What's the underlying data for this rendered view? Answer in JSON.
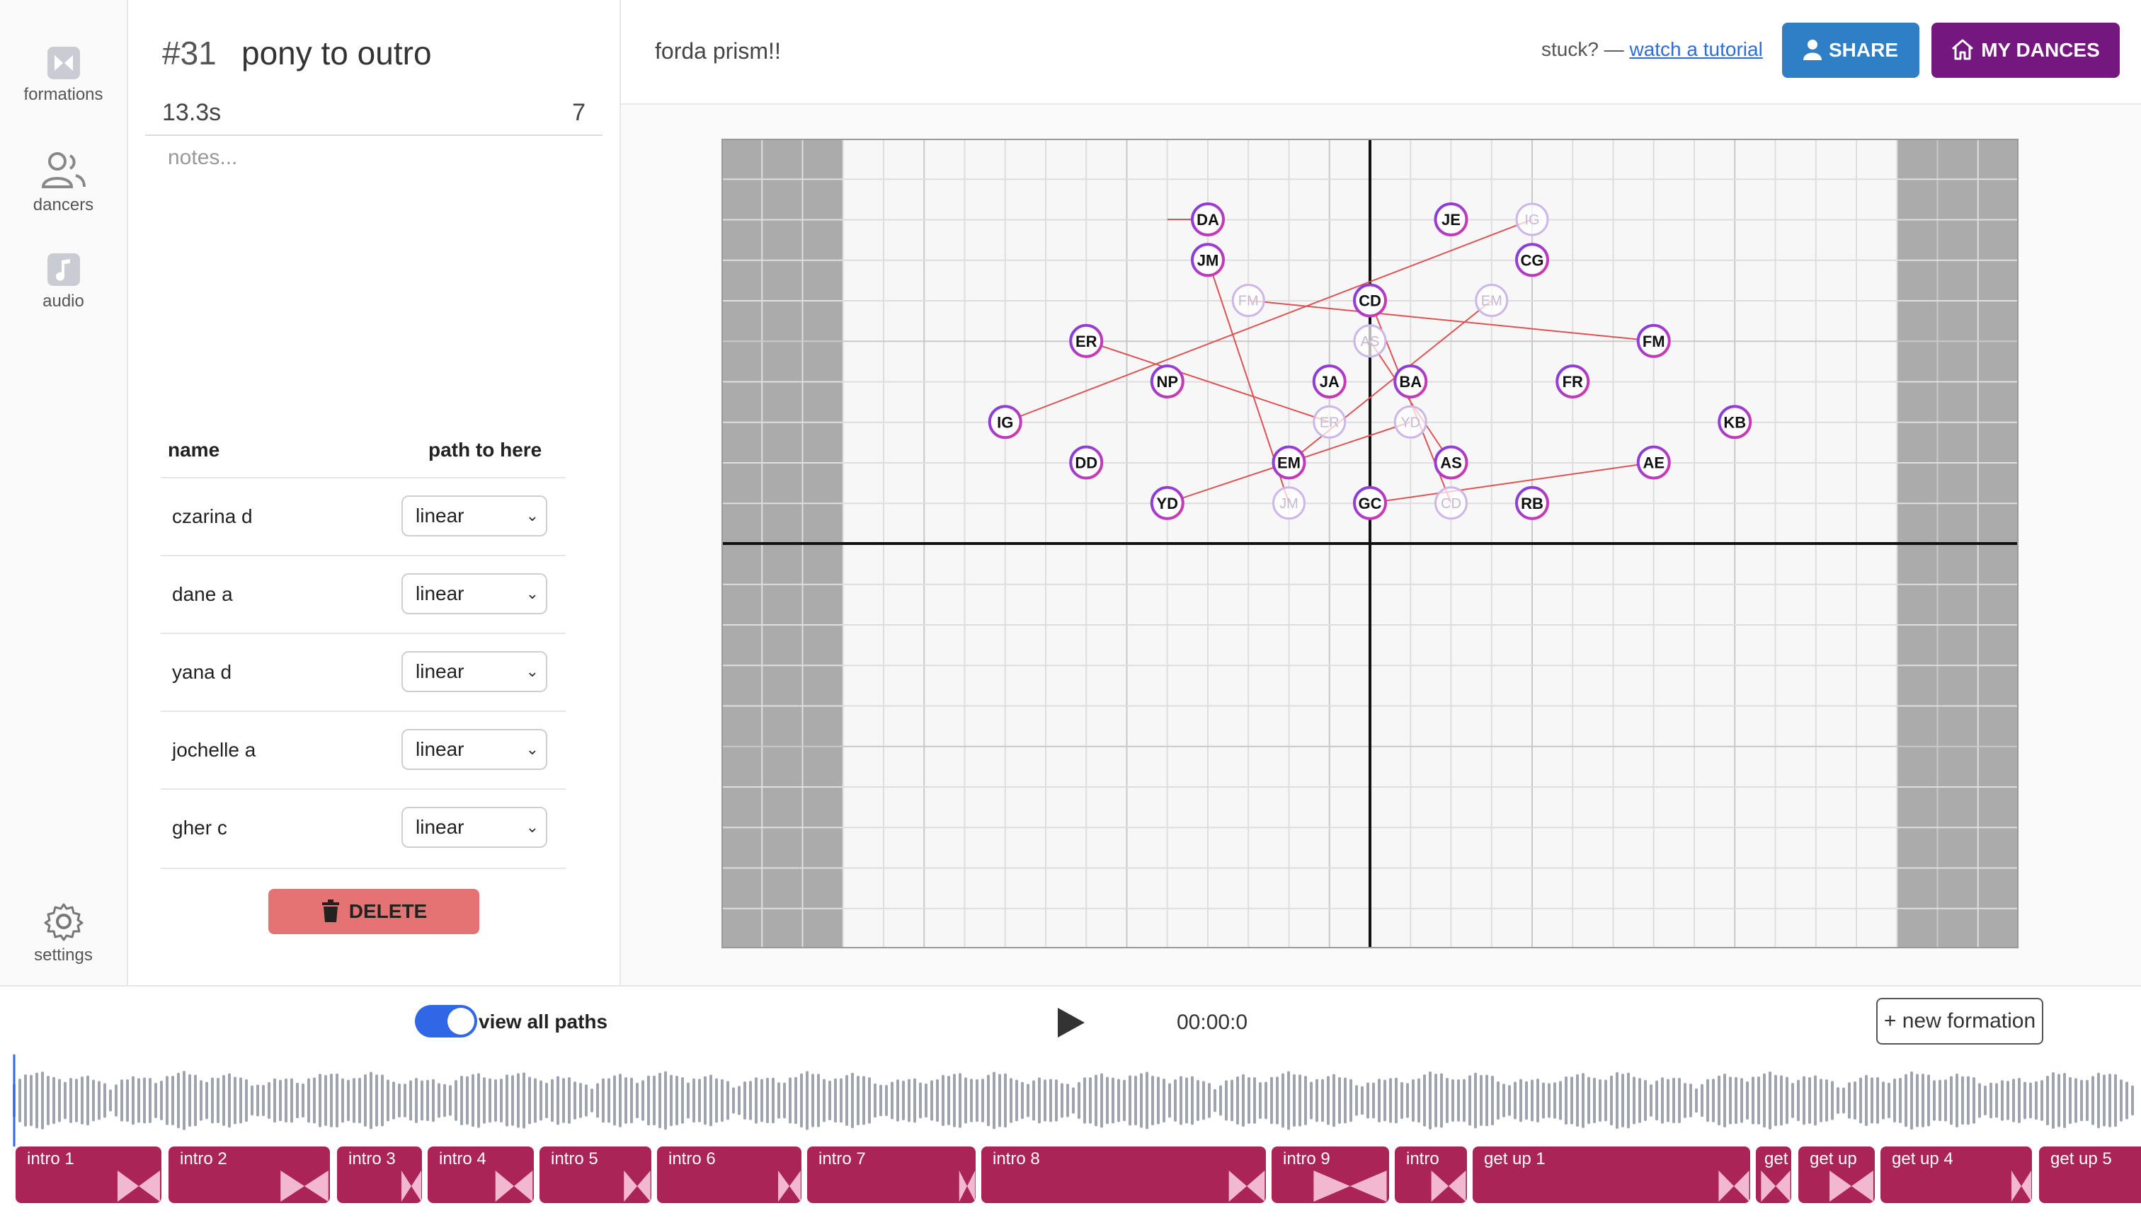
{
  "sidebar": {
    "items": [
      {
        "label": "formations",
        "icon": "bowtie-icon"
      },
      {
        "label": "dancers",
        "icon": "users-icon"
      },
      {
        "label": "audio",
        "icon": "music-note-icon"
      }
    ],
    "settings": {
      "label": "settings",
      "icon": "gear-icon"
    }
  },
  "formation": {
    "number": "#31",
    "name": "pony to outro",
    "duration": "13.3s",
    "count": "7",
    "notes_placeholder": "notes...",
    "table": {
      "col_name": "name",
      "col_path": "path to here",
      "rows": [
        {
          "name": "czarina d",
          "path": "linear"
        },
        {
          "name": "dane a",
          "path": "linear"
        },
        {
          "name": "yana d",
          "path": "linear"
        },
        {
          "name": "jochelle a",
          "path": "linear"
        },
        {
          "name": "gher c",
          "path": "linear"
        }
      ]
    },
    "delete_label": "DELETE"
  },
  "header": {
    "dance_title": "forda prism!!",
    "stuck_text": "stuck? — ",
    "tutorial_link": "watch a tutorial",
    "share_label": "SHARE",
    "my_dances_label": "MY DANCES"
  },
  "stage": {
    "dancers": [
      {
        "id": "DA",
        "x": -4,
        "y": 8
      },
      {
        "id": "JE",
        "x": 2,
        "y": 8
      },
      {
        "id": "JM",
        "x": -4,
        "y": 7
      },
      {
        "id": "CG",
        "x": 4,
        "y": 7
      },
      {
        "id": "CD",
        "x": 0,
        "y": 6
      },
      {
        "id": "ER",
        "x": -7,
        "y": 5
      },
      {
        "id": "FM",
        "x": 7,
        "y": 5
      },
      {
        "id": "NP",
        "x": -5,
        "y": 4
      },
      {
        "id": "JA",
        "x": -1,
        "y": 4
      },
      {
        "id": "BA",
        "x": 1,
        "y": 4
      },
      {
        "id": "FR",
        "x": 5,
        "y": 4
      },
      {
        "id": "IG",
        "x": -9,
        "y": 3
      },
      {
        "id": "KB",
        "x": 9,
        "y": 3
      },
      {
        "id": "DD",
        "x": -7,
        "y": 2
      },
      {
        "id": "EM",
        "x": -2,
        "y": 2
      },
      {
        "id": "AS",
        "x": 2,
        "y": 2
      },
      {
        "id": "AE",
        "x": 7,
        "y": 2
      },
      {
        "id": "YD",
        "x": -5,
        "y": 1
      },
      {
        "id": "GC",
        "x": 0,
        "y": 1
      },
      {
        "id": "RB",
        "x": 4,
        "y": 1
      }
    ],
    "ghosts": [
      {
        "id": "DA",
        "x": -4,
        "y": 8
      },
      {
        "id": "IG",
        "x": 4,
        "y": 8
      },
      {
        "id": "FM",
        "x": -3,
        "y": 6
      },
      {
        "id": "EM",
        "x": 3,
        "y": 6
      },
      {
        "id": "AS",
        "x": 0,
        "y": 5
      },
      {
        "id": "ER",
        "x": -1,
        "y": 3
      },
      {
        "id": "YD",
        "x": 1,
        "y": 3
      },
      {
        "id": "JM",
        "x": -2,
        "y": 1
      },
      {
        "id": "CD",
        "x": 2,
        "y": 1
      }
    ],
    "paths": [
      {
        "from": [
          -5,
          8
        ],
        "to": [
          -4,
          8
        ]
      },
      {
        "from": [
          4,
          8
        ],
        "to": [
          -9,
          3
        ]
      },
      {
        "from": [
          -3,
          6
        ],
        "to": [
          7,
          5
        ]
      },
      {
        "from": [
          3,
          6
        ],
        "to": [
          -2,
          2
        ]
      },
      {
        "from": [
          0,
          5
        ],
        "to": [
          2,
          2
        ]
      },
      {
        "from": [
          -1,
          3
        ],
        "to": [
          -7,
          5
        ]
      },
      {
        "from": [
          1,
          3
        ],
        "to": [
          -5,
          1
        ]
      },
      {
        "from": [
          -2,
          1
        ],
        "to": [
          -4,
          7
        ]
      },
      {
        "from": [
          2,
          1
        ],
        "to": [
          0,
          6
        ]
      },
      {
        "from": [
          0,
          1
        ],
        "to": [
          7,
          2
        ]
      }
    ]
  },
  "controls": {
    "view_all_paths_label": "view all paths",
    "view_all_paths_on": true,
    "timecode": "00:00:0",
    "new_formation_label": "+ new formation"
  },
  "timeline": {
    "formations": [
      {
        "label": "intro 1"
      },
      {
        "label": "intro 2"
      },
      {
        "label": "intro 3"
      },
      {
        "label": "intro 4"
      },
      {
        "label": "intro 5"
      },
      {
        "label": "intro 6"
      },
      {
        "label": "intro 7"
      },
      {
        "label": "intro 8"
      },
      {
        "label": "intro 9"
      },
      {
        "label": "intro"
      },
      {
        "label": "get up 1"
      },
      {
        "label": "get"
      },
      {
        "label": "get up"
      },
      {
        "label": "get up 4"
      },
      {
        "label": "get up 5"
      }
    ]
  },
  "colors": {
    "accent": "#2f67e6",
    "share": "#2f7fc7",
    "my_dances": "#74177e",
    "delete": "#e57373",
    "formation_block": "#ab2457",
    "path_line": "#e05252"
  }
}
